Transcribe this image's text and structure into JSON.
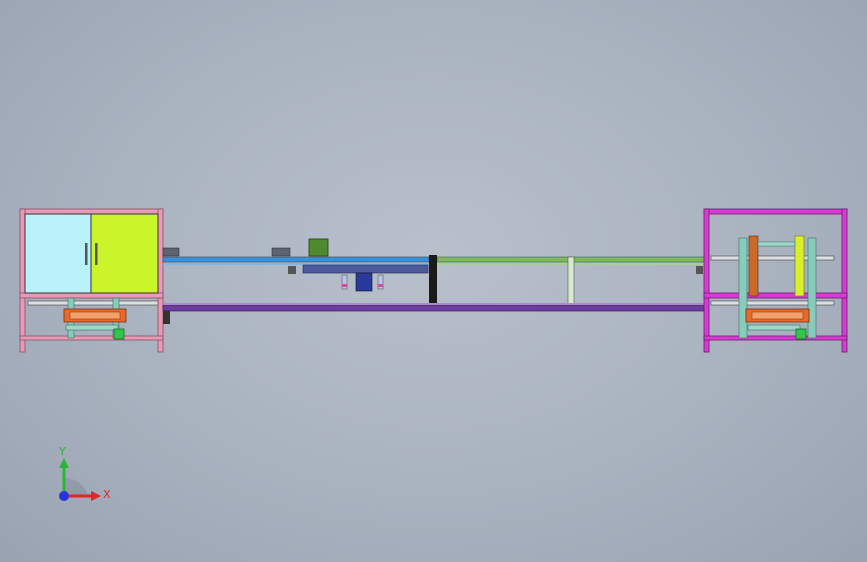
{
  "colors": {
    "left_frame": "#e59bb5",
    "right_frame": "#d43cd3",
    "cabinet_door_left": "#b9f2fb",
    "cabinet_door_right": "#c9f52a",
    "conveyor_blue": "#3f8fd6",
    "conveyor_green": "#7fb865",
    "rail_purple": "#6b3d9c",
    "motor_green": "#4f8b2e",
    "column_orange": "#c96a2a",
    "column_yellow": "#d8ef2a",
    "column_teal": "#86cdbb",
    "axis_x": "#e0262a",
    "axis_y": "#2cb53a",
    "axis_z": "#2a33d8"
  },
  "triad": {
    "x_label": "X",
    "y_label": "Y"
  }
}
